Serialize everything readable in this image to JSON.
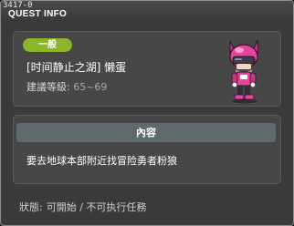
{
  "window": {
    "quest_id": "3417-0",
    "title": "QUEST INFO"
  },
  "quest": {
    "category": "一般",
    "name": "[时间静止之湖] 懒蛋",
    "level_label": "建議等級:",
    "level_range": "65~69",
    "npc_icon": "pink-robot-npc-icon"
  },
  "content": {
    "header": "內容",
    "text": "要去地球本部附近找冒险勇者粉狼"
  },
  "status": {
    "label": "狀態:",
    "value": "可開始 / 不可执行任務"
  },
  "colors": {
    "window_bg": "#3a3a3a",
    "panel_bg": "#474747",
    "badge_green": "#8bb52a",
    "content_header_bg": "#5f6a6c",
    "npc_pink": "#e2459a"
  }
}
